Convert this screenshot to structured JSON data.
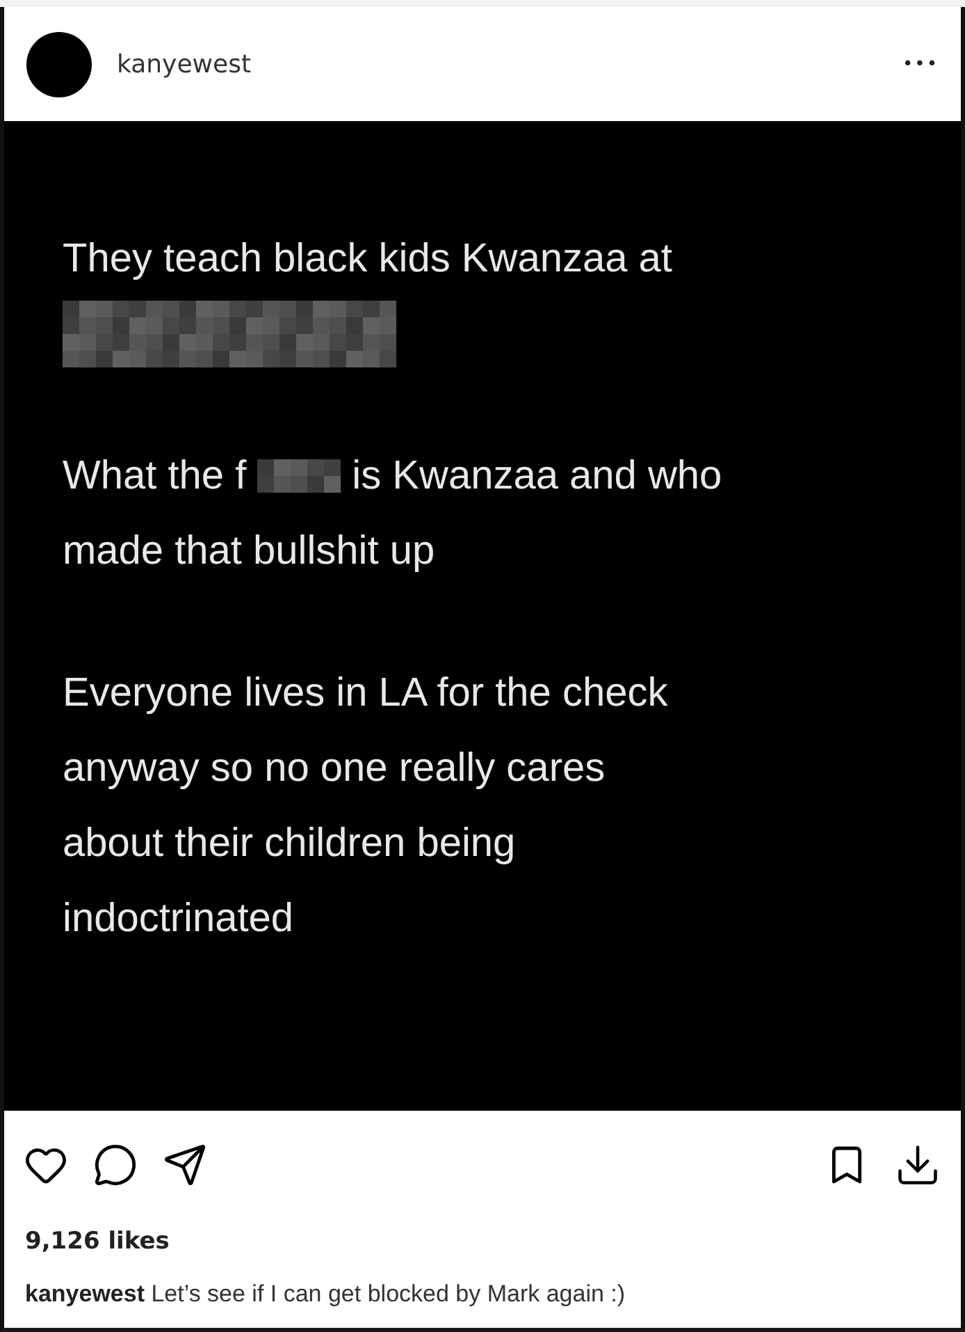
{
  "header": {
    "username": "kanyewest",
    "more": "•••"
  },
  "post": {
    "paragraphs": [
      {
        "lines": [
          [
            {
              "kind": "text",
              "text": "They teach black kids Kwanzaa at"
            }
          ],
          [
            {
              "kind": "redacted_line"
            }
          ]
        ]
      },
      {
        "lines": [
          [
            {
              "kind": "text",
              "text": "What the f"
            },
            {
              "kind": "redacted_word"
            },
            {
              "kind": "text",
              "text": "is Kwanzaa and who"
            }
          ],
          [
            {
              "kind": "text",
              "text": "made that bullshit up"
            }
          ]
        ]
      },
      {
        "lines": [
          [
            {
              "kind": "text",
              "text": "Everyone lives in LA for the check"
            }
          ],
          [
            {
              "kind": "text",
              "text": "anyway so no one really cares"
            }
          ],
          [
            {
              "kind": "text",
              "text": "about their children being"
            }
          ],
          [
            {
              "kind": "text",
              "text": "indoctrinated"
            }
          ]
        ]
      }
    ]
  },
  "likes": "9,126 likes",
  "caption": "**kanyewest** Let’s see if I can get blocked by Mark again :)"
}
